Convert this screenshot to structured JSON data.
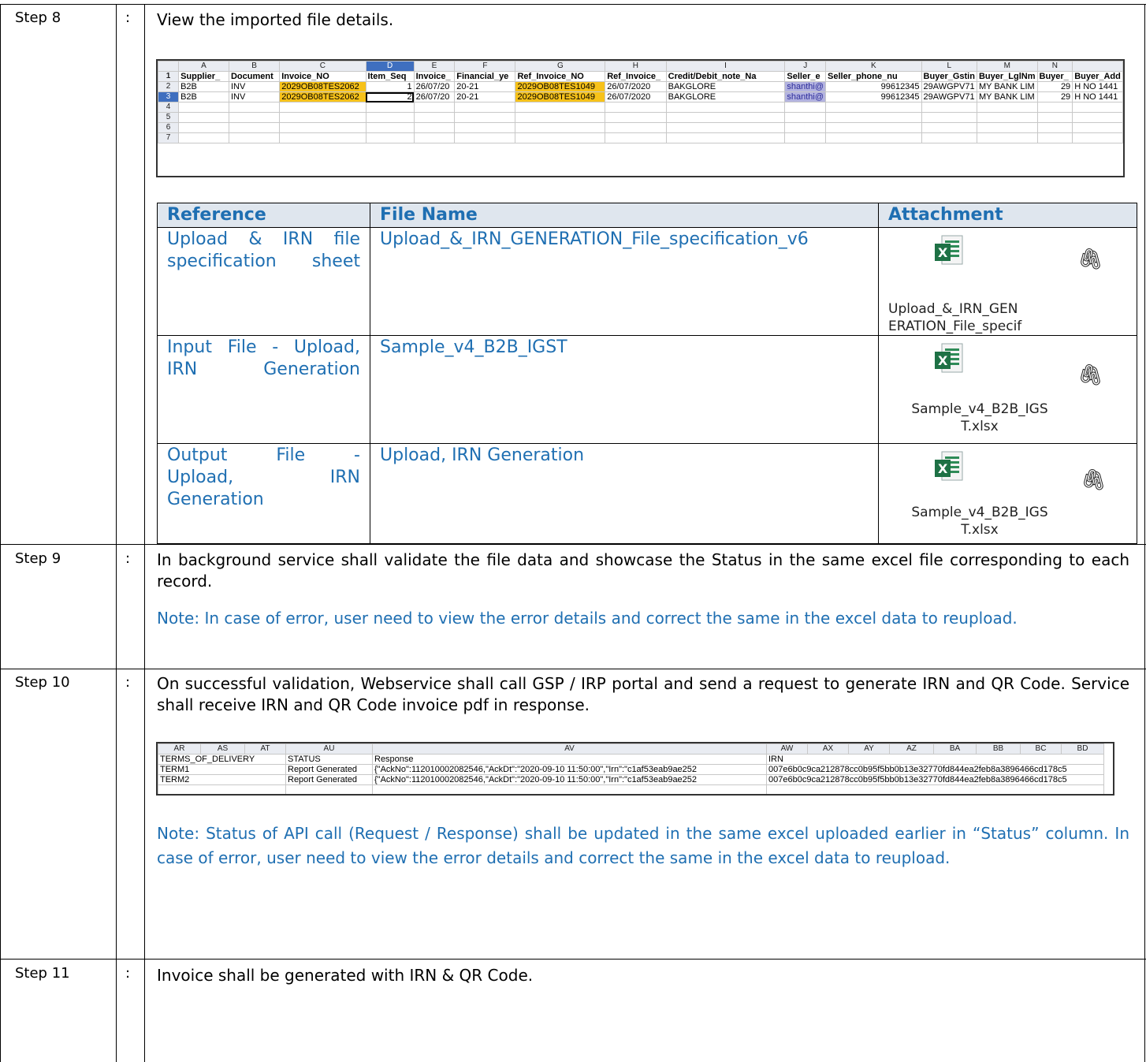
{
  "steps": [
    {
      "label": "Step 8",
      "colon": ":"
    },
    {
      "label": "Step 9",
      "colon": ":"
    },
    {
      "label": "Step 10",
      "colon": ":"
    },
    {
      "label": "Step 11",
      "colon": ":"
    }
  ],
  "step8": {
    "text": "View the imported file details.",
    "sheet": {
      "columns": [
        "A",
        "B",
        "C",
        "D",
        "E",
        "F",
        "G",
        "H",
        "I",
        "J",
        "K",
        "L",
        "M",
        "N",
        ""
      ],
      "rows": [
        [
          "Supplier_",
          "Document",
          "Invoice_NO",
          "Item_Seq",
          "Invoice_",
          "Financial_ye",
          "Ref_Invoice_NO",
          "Ref_Invoice_",
          "Credit/Debit_note_Na",
          "Seller_e",
          "Seller_phone_nu",
          "Buyer_Gstin",
          "Buyer_LglNm",
          "Buyer_",
          "Buyer_Add"
        ],
        [
          "B2B",
          "INV",
          "2029OB08TES2062",
          "1",
          "26/07/20",
          "20-21",
          "2029OB08TES1049",
          "26/07/2020",
          "BAKGLORE",
          "shanthi@",
          "99612345",
          "29AWGPV71",
          "MY BANK LIM",
          "29",
          "H NO 1441"
        ],
        [
          "B2B",
          "INV",
          "2029OB08TES2062",
          "2",
          "26/07/20",
          "20-21",
          "2029OB08TES1049",
          "26/07/2020",
          "BAKGLORE",
          "shanthi@",
          "99612345",
          "29AWGPV71",
          "MY BANK LIM",
          "29",
          "H NO 1441"
        ],
        [
          "",
          "",
          "",
          "",
          "",
          "",
          "",
          "",
          "",
          "",
          "",
          "",
          "",
          "",
          ""
        ],
        [
          "",
          "",
          "",
          "",
          "",
          "",
          "",
          "",
          "",
          "",
          "",
          "",
          "",
          "",
          ""
        ],
        [
          "",
          "",
          "",
          "",
          "",
          "",
          "",
          "",
          "",
          "",
          "",
          "",
          "",
          "",
          ""
        ],
        [
          "",
          "",
          "",
          "",
          "",
          "",
          "",
          "",
          "",
          "",
          "",
          "",
          "",
          "",
          ""
        ]
      ],
      "row_numbers": [
        "1",
        "2",
        "3",
        "4",
        "5",
        "6",
        "7"
      ]
    },
    "ref_table": {
      "headers": [
        "Reference",
        "File Name",
        "Attachment"
      ],
      "rows": [
        {
          "reference": "Upload & IRN file specification sheet",
          "file": "Upload_&_IRN_GENERATION_File_specification_v6",
          "attach_line1": "Upload_&_IRN_GEN",
          "attach_line2": "ERATION_File_specif"
        },
        {
          "reference": "Input File - Upload, IRN Generation",
          "file": "Sample_v4_B2B_IGST",
          "attach_line1": "Sample_v4_B2B_IGS",
          "attach_line2": "T.xlsx"
        },
        {
          "reference_l1": "Output File -",
          "reference_l2": "Upload, IRN",
          "reference_l3": "Generation",
          "file": "Upload, IRN Generation",
          "attach_line1": "Sample_v4_B2B_IGS",
          "attach_line2": "T.xlsx"
        }
      ]
    }
  },
  "step9": {
    "text": "In background service shall validate the file data and showcase the Status in the same excel file corresponding to each record.",
    "note": "Note: In case of error, user need to view the error details and correct the same in the excel data to reupload."
  },
  "step10": {
    "text": "On successful validation, Webservice shall call GSP / IRP portal and send a request to generate IRN and QR Code. Service shall receive IRN and QR Code invoice pdf in response.",
    "sheet": {
      "columns": [
        "AR",
        "AS",
        "AT",
        "AU",
        "AV",
        "AW",
        "AX",
        "AY",
        "AZ",
        "BA",
        "BB",
        "BC",
        "BD"
      ],
      "header_row": [
        "TERMS_OF_DELIVERY",
        "STATUS",
        "Response",
        "IRN"
      ],
      "rows": [
        {
          "term": "TERM1",
          "status": "Report Generated",
          "response": "{\"AckNo\":112010002082546,\"AckDt\":\"2020-09-10 11:50:00\",\"Irn\":\"c1af53eab9ae252",
          "irn": "007e6b0c9ca212878cc0b95f5bb0b13e32770fd844ea2feb8a3896466cd178c5"
        },
        {
          "term": "TERM2",
          "status": "Report Generated",
          "response": "{\"AckNo\":112010002082546,\"AckDt\":\"2020-09-10 11:50:00\",\"Irn\":\"c1af53eab9ae252",
          "irn": "007e6b0c9ca212878cc0b95f5bb0b13e32770fd844ea2feb8a3896466cd178c5"
        }
      ]
    },
    "note": "Note: Status of API call (Request / Response) shall be updated in the same excel uploaded earlier in “Status” column. In case of error, user need to view the error details and correct the same in the excel data to reupload."
  },
  "step11": {
    "text": "Invoice shall be generated with IRN & QR Code."
  }
}
